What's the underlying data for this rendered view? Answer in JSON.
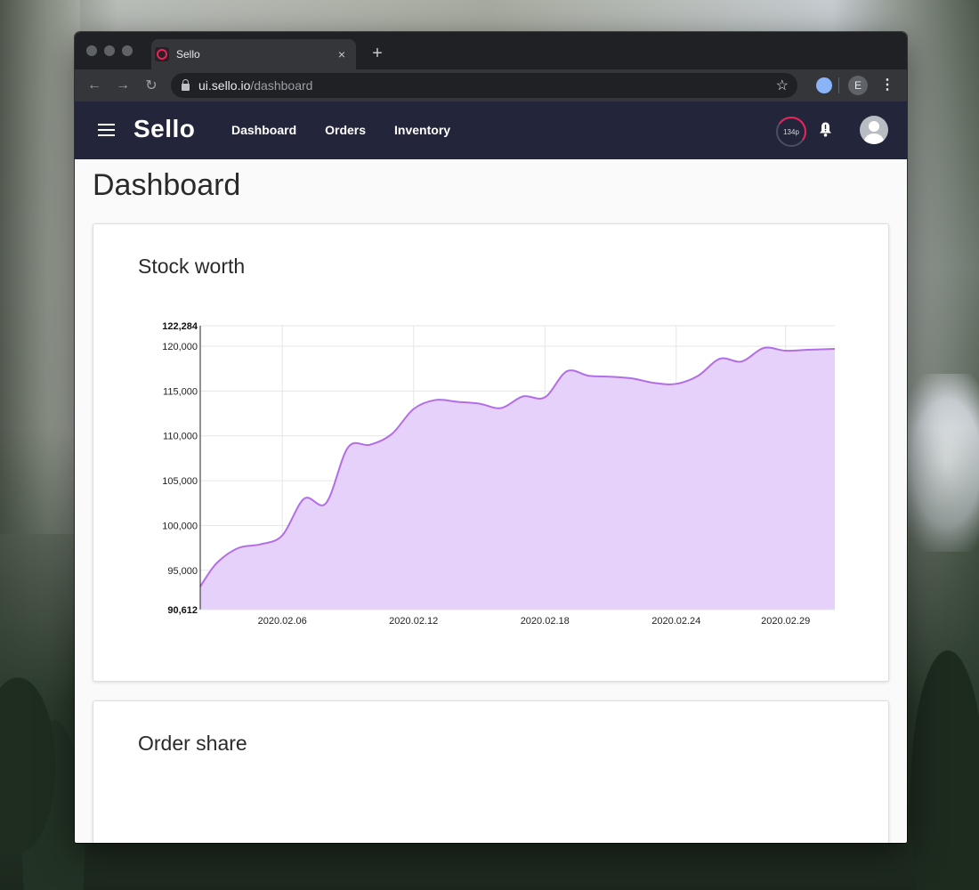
{
  "browser": {
    "tab_title": "Sello",
    "tab_close": "×",
    "new_tab": "+",
    "url_host": "ui.sello.io",
    "url_path": "/dashboard",
    "profile_initial": "E"
  },
  "app": {
    "brand": "Sello",
    "nav": [
      "Dashboard",
      "Orders",
      "Inventory"
    ],
    "points_badge": "134p"
  },
  "page": {
    "title": "Dashboard",
    "stock_card_title": "Stock worth",
    "order_card_title": "Order share"
  },
  "colors": {
    "appbar": "#23263a",
    "series_line": "#b26ee9",
    "series_fill": "#e6d1fb",
    "accent": "#e8245b"
  },
  "chart_data": {
    "type": "area",
    "title": "Stock worth",
    "xlabel": "",
    "ylabel": "",
    "ylim": [
      90612,
      122284
    ],
    "y_ticks": [
      95000,
      100000,
      105000,
      110000,
      115000,
      120000
    ],
    "y_tick_labels": [
      "95,000",
      "100,000",
      "105,000",
      "110,000",
      "115,000",
      "120,000"
    ],
    "y_min_label": "90,612",
    "y_max_label": "122,284",
    "x_tick_labels": [
      "2020.02.06",
      "2020.02.12",
      "2020.02.18",
      "2020.02.24",
      "2020.02.29"
    ],
    "x_tick_dates": [
      "2020-02-06",
      "2020-02-12",
      "2020-02-18",
      "2020-02-24",
      "2020-02-29"
    ],
    "x_range": [
      "2020-02-02 06:00",
      "2020-03-02 06:00"
    ],
    "grid": true,
    "series": [
      {
        "points": [
          [
            "2020-02-02 06:00",
            93200
          ],
          [
            "2020-02-03 00:00",
            95800
          ],
          [
            "2020-02-04 00:00",
            97500
          ],
          [
            "2020-02-05 00:00",
            97900
          ],
          [
            "2020-02-06 00:00",
            98900
          ],
          [
            "2020-02-07 00:00",
            103000
          ],
          [
            "2020-02-08 00:00",
            102500
          ],
          [
            "2020-02-09 00:00",
            108700
          ],
          [
            "2020-02-10 00:00",
            109000
          ],
          [
            "2020-02-11 00:00",
            110200
          ],
          [
            "2020-02-12 00:00",
            113000
          ],
          [
            "2020-02-13 00:00",
            114000
          ],
          [
            "2020-02-14 00:00",
            113800
          ],
          [
            "2020-02-15 00:00",
            113600
          ],
          [
            "2020-02-16 00:00",
            113100
          ],
          [
            "2020-02-17 00:00",
            114400
          ],
          [
            "2020-02-18 00:00",
            114300
          ],
          [
            "2020-02-19 00:00",
            117200
          ],
          [
            "2020-02-20 00:00",
            116700
          ],
          [
            "2020-02-21 00:00",
            116600
          ],
          [
            "2020-02-22 00:00",
            116400
          ],
          [
            "2020-02-23 00:00",
            115900
          ],
          [
            "2020-02-24 00:00",
            115800
          ],
          [
            "2020-02-25 00:00",
            116700
          ],
          [
            "2020-02-26 00:00",
            118600
          ],
          [
            "2020-02-27 00:00",
            118300
          ],
          [
            "2020-02-28 00:00",
            119800
          ],
          [
            "2020-02-29 00:00",
            119500
          ],
          [
            "2020-03-01 00:00",
            119600
          ],
          [
            "2020-03-02 06:00",
            119700
          ]
        ]
      }
    ]
  }
}
